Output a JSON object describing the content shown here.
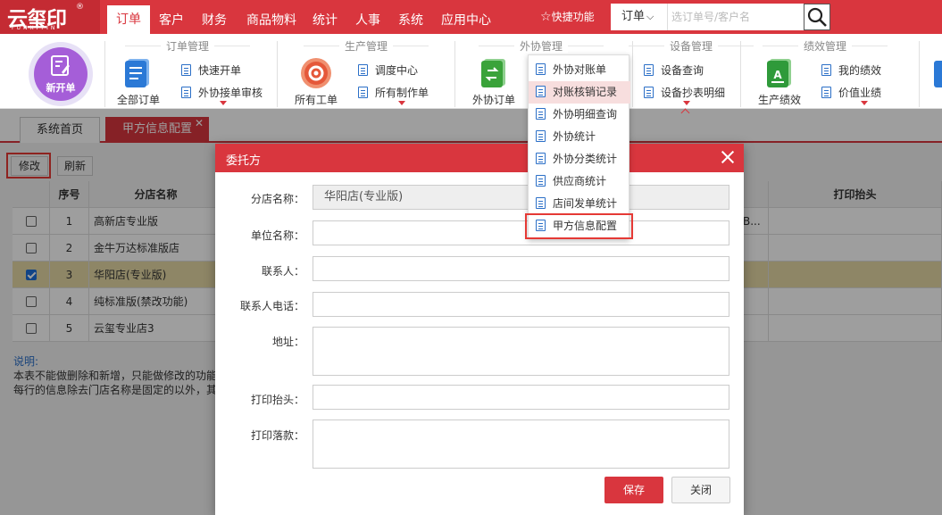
{
  "brand": {
    "logo_text": "云玺印",
    "logo_sub": "YUNXIYIN",
    "reg_mark": "®"
  },
  "nav": {
    "items": [
      "订单",
      "客户",
      "财务",
      "商品物料",
      "统计",
      "人事",
      "系统",
      "应用中心"
    ],
    "active": "订单",
    "quick_label": "快捷功能"
  },
  "search": {
    "type": "订单",
    "placeholder": "选订单号/客户名"
  },
  "ribbon": {
    "new_order": "新开单",
    "groups": {
      "order_mgmt": "订单管理",
      "production_mgmt": "生产管理",
      "outsource_mgmt": "外协管理",
      "equipment_mgmt": "设备管理",
      "performance_mgmt": "绩效管理"
    },
    "all_orders": "全部订单",
    "quick_order": "快速开单",
    "outsource_review": "外协接单审核",
    "all_work_orders": "所有工单",
    "dispatch_center": "调度中心",
    "all_production_orders": "所有制作单",
    "outsource_orders": "外协订单",
    "equipment_query": "设备查询",
    "meter_detail": "设备抄表明细",
    "production_performance": "生产绩效",
    "my_performance": "我的绩效",
    "value_performance": "价值业绩"
  },
  "dropdown": {
    "items": [
      "外协对账单",
      "对账核销记录",
      "外协明细查询",
      "外协统计",
      "外协分类统计",
      "供应商统计",
      "店间发单统计",
      "甲方信息配置"
    ],
    "hovered": "对账核销记录",
    "highlighted": "甲方信息配置"
  },
  "tabs": {
    "home": "系统首页",
    "current": "甲方信息配置"
  },
  "toolbar": {
    "modify": "修改",
    "refresh": "刷新"
  },
  "table": {
    "headers": {
      "seq": "序号",
      "store": "分店名称",
      "print_header": "打印抬头"
    },
    "rows": [
      {
        "seq": "1",
        "store": "高新店专业版",
        "checked": false,
        "extra": "B..."
      },
      {
        "seq": "2",
        "store": "金牛万达标准版店",
        "checked": false,
        "extra": ""
      },
      {
        "seq": "3",
        "store": "华阳店(专业版)",
        "checked": true,
        "extra": ""
      },
      {
        "seq": "4",
        "store": "纯标准版(禁改功能)",
        "checked": false,
        "extra": ""
      },
      {
        "seq": "5",
        "store": "云玺专业店3",
        "checked": false,
        "extra": ""
      }
    ]
  },
  "notes": {
    "title": "说明:",
    "line1": "本表不能做删除和新增，只能做修改的功能",
    "line2": "每行的信息除去门店名称是固定的以外，其"
  },
  "modal": {
    "title": "委托方",
    "fields": {
      "store_name_label": "分店名称：",
      "store_name_value": "华阳店(专业版)",
      "unit_name_label": "单位名称：",
      "contact_label": "联系人：",
      "contact_phone_label": "联系人电话：",
      "address_label": "地址：",
      "print_header_label": "打印抬头：",
      "print_footer_label": "打印落款："
    },
    "save": "保存",
    "close": "关闭"
  },
  "colors": {
    "brand_red": "#d9363e",
    "link_blue": "#2b6fc7",
    "selected_row": "#e6d9a5"
  }
}
